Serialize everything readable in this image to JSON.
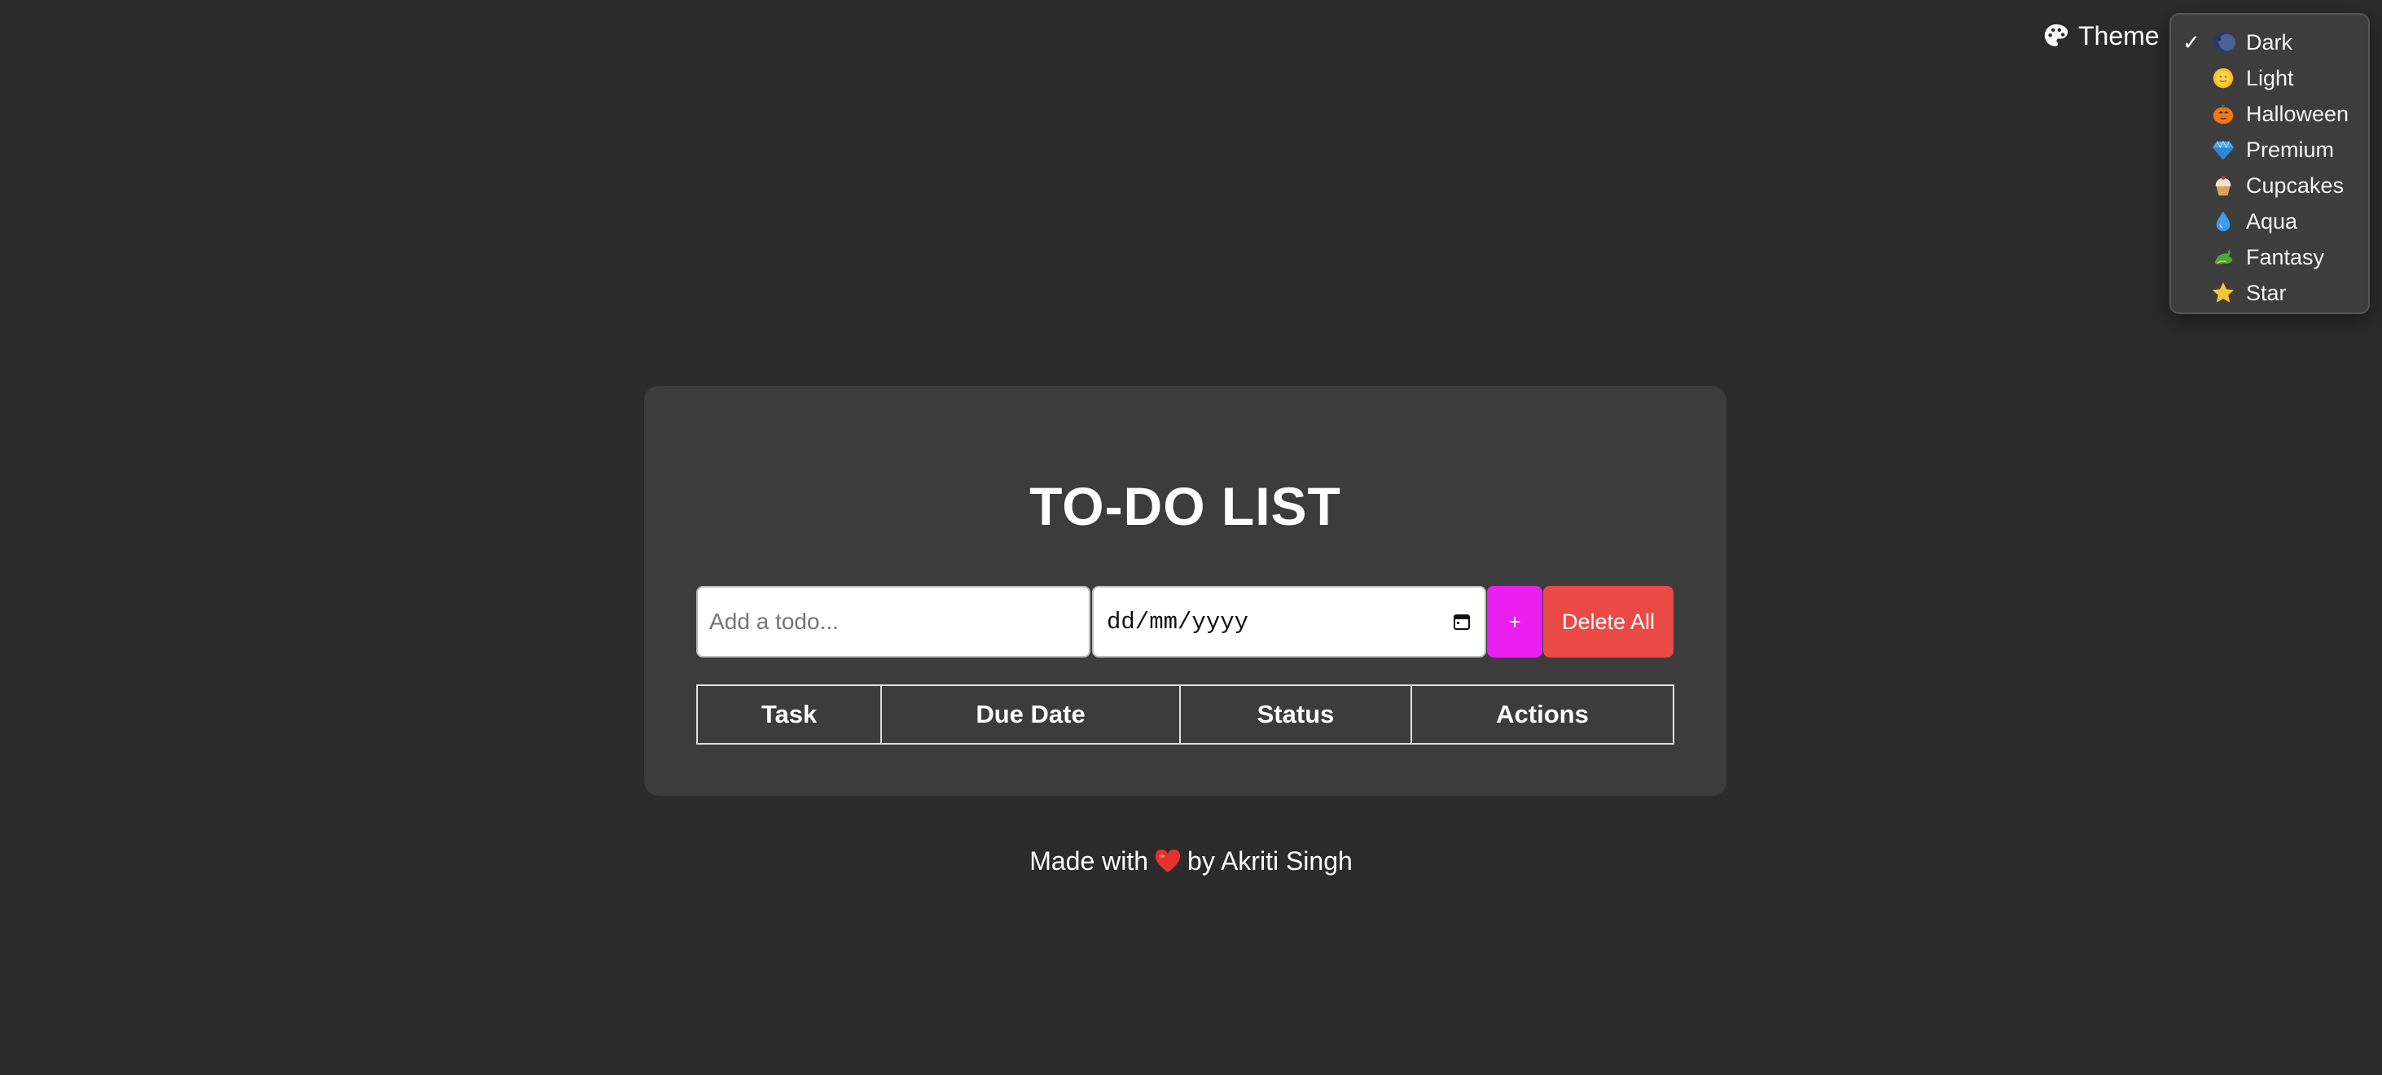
{
  "theme_switcher": {
    "label": "Theme",
    "icon": "palette-icon",
    "selected": "Dark",
    "options": [
      {
        "name": "Dark",
        "emoji": "moon",
        "checked": true
      },
      {
        "name": "Light",
        "emoji": "sun",
        "checked": false
      },
      {
        "name": "Halloween",
        "emoji": "pumpkin",
        "checked": false
      },
      {
        "name": "Premium",
        "emoji": "diamond",
        "checked": false
      },
      {
        "name": "Cupcakes",
        "emoji": "cupcake",
        "checked": false
      },
      {
        "name": "Aqua",
        "emoji": "droplet",
        "checked": false
      },
      {
        "name": "Fantasy",
        "emoji": "dragon",
        "checked": false
      },
      {
        "name": "Star",
        "emoji": "star",
        "checked": false
      }
    ],
    "check_mark": "✓"
  },
  "app": {
    "title": "TO-DO LIST",
    "todo_input": {
      "placeholder": "Add a todo...",
      "value": ""
    },
    "date_input": {
      "placeholder": "dd/mm/yyyy"
    },
    "add_button": "+",
    "delete_all_button": "Delete All",
    "table": {
      "headers": [
        "Task",
        "Due Date",
        "Status",
        "Actions"
      ],
      "rows": []
    }
  },
  "footer": {
    "prefix": "Made with",
    "emoji": "heart",
    "suffix": "by Akriti Singh"
  },
  "colors": {
    "background": "#2b2b2b",
    "card": "#3c3c3c",
    "add_button": "#e91ff0",
    "delete_button": "#ea4a45"
  }
}
